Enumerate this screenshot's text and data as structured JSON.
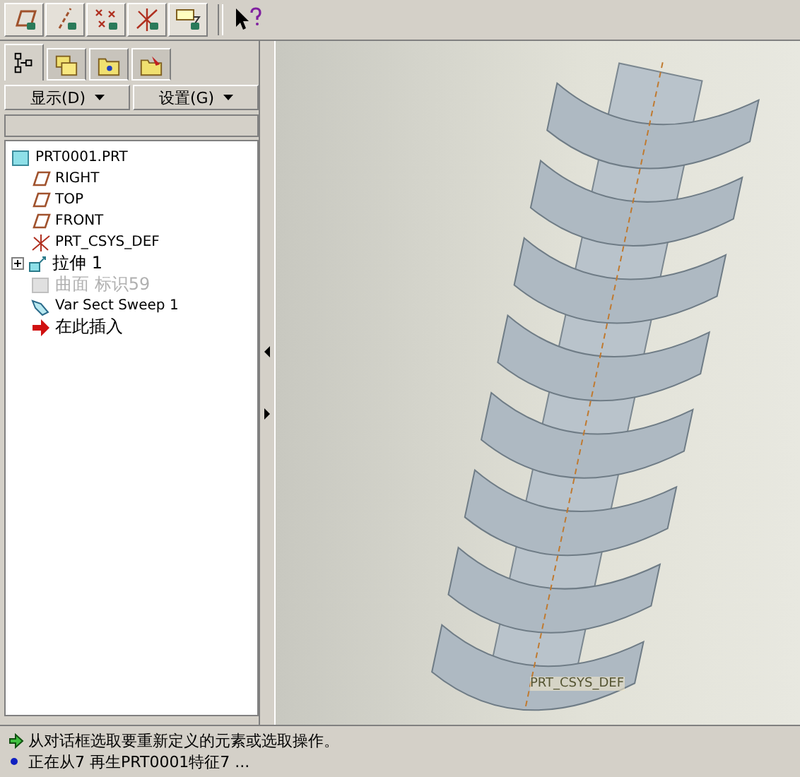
{
  "toolbar": {
    "tools": [
      {
        "kind": "plane"
      },
      {
        "kind": "axis"
      },
      {
        "kind": "point"
      },
      {
        "kind": "csys"
      },
      {
        "kind": "note"
      }
    ]
  },
  "navigator": {
    "tabs": [
      {
        "kind": "tree",
        "selected": true
      },
      {
        "kind": "layers",
        "selected": false
      },
      {
        "kind": "folder",
        "selected": false
      },
      {
        "kind": "favorites",
        "selected": false
      }
    ],
    "buttons": [
      "显示(D)",
      "设置(G)"
    ],
    "tree": {
      "label": "PRT0001.PRT",
      "children": [
        {
          "kind": "plane",
          "label": "RIGHT",
          "disabled": false
        },
        {
          "kind": "plane",
          "label": "TOP",
          "disabled": false
        },
        {
          "kind": "plane",
          "label": "FRONT",
          "disabled": false
        },
        {
          "kind": "csys",
          "label": "PRT_CSYS_DEF",
          "disabled": false
        },
        {
          "kind": "extrude",
          "label": "拉伸 1",
          "disabled": false,
          "expanded": false
        },
        {
          "kind": "surface",
          "label": "曲面 标识59",
          "disabled": true
        },
        {
          "kind": "sweep",
          "label": "Var Sect Sweep 1",
          "disabled": false
        },
        {
          "kind": "insert",
          "label": "在此插入",
          "disabled": false
        }
      ]
    }
  },
  "viewport": {
    "csys_label": "PRT_CSYS_DEF"
  },
  "messages": [
    {
      "kind": "prompt",
      "text": "从对话框选取要重新定义的元素或选取操作。"
    },
    {
      "kind": "info",
      "text": "正在从7 再生PRT0001特征7 ..."
    }
  ]
}
